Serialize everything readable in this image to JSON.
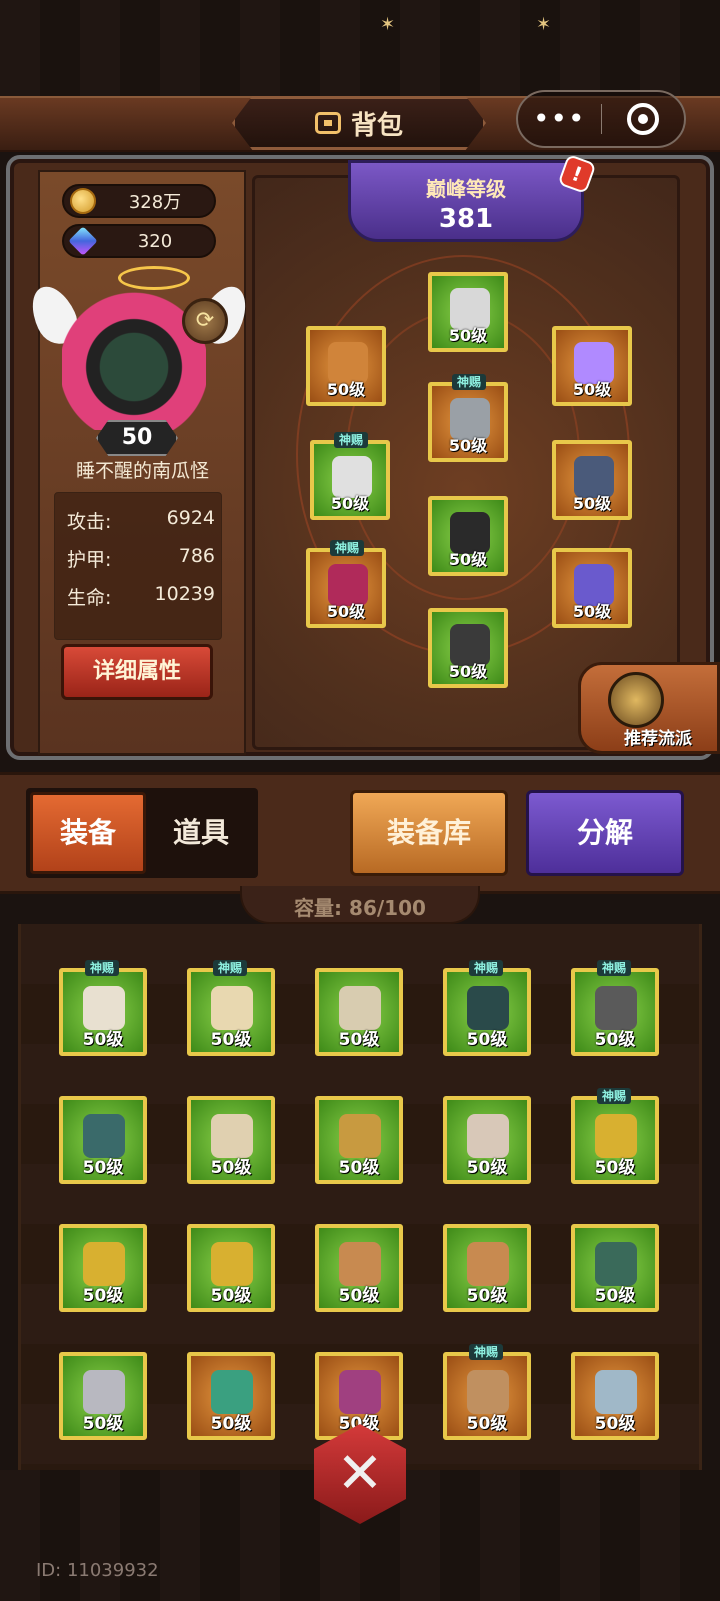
{
  "header": {
    "title": "背包",
    "title_icon": "backpack-icon",
    "more_label": "•••"
  },
  "currency": {
    "coins": "328万",
    "gems": "320"
  },
  "character": {
    "level": "50",
    "name": "睡不醒的南瓜怪"
  },
  "stats": [
    {
      "label": "攻击:",
      "value": "6924"
    },
    {
      "label": "护甲:",
      "value": "786"
    },
    {
      "label": "生命:",
      "value": "10239"
    }
  ],
  "detail_button": "详细属性",
  "peak": {
    "title": "巅峰等级",
    "value": "381",
    "alert": "!"
  },
  "equipped": [
    {
      "slot": "helmet",
      "level": "50级",
      "tag": "",
      "rarity": "green"
    },
    {
      "slot": "shoulder",
      "level": "50级",
      "tag": "",
      "rarity": "orange"
    },
    {
      "slot": "necklace",
      "level": "50级",
      "tag": "",
      "rarity": "orange"
    },
    {
      "slot": "armor",
      "level": "50级",
      "tag": "神赐",
      "rarity": "orange"
    },
    {
      "slot": "gloves",
      "level": "50级",
      "tag": "神赐",
      "rarity": "green"
    },
    {
      "slot": "bracelet",
      "level": "50级",
      "tag": "",
      "rarity": "orange"
    },
    {
      "slot": "pants",
      "level": "50级",
      "tag": "",
      "rarity": "green"
    },
    {
      "slot": "weapon",
      "level": "50级",
      "tag": "神赐",
      "rarity": "orange"
    },
    {
      "slot": "ring",
      "level": "50级",
      "tag": "",
      "rarity": "orange"
    },
    {
      "slot": "boots",
      "level": "50级",
      "tag": "",
      "rarity": "green"
    }
  ],
  "recommend_label": "推荐流派",
  "tabs": {
    "equipment": "装备",
    "items": "道具"
  },
  "buttons": {
    "storage": "装备库",
    "decompose": "分解"
  },
  "capacity": "容量: 86/100",
  "inventory": [
    {
      "level": "50级",
      "tag": "神赐",
      "rarity": "green"
    },
    {
      "level": "50级",
      "tag": "神赐",
      "rarity": "green"
    },
    {
      "level": "50级",
      "tag": "",
      "rarity": "green"
    },
    {
      "level": "50级",
      "tag": "神赐",
      "rarity": "green"
    },
    {
      "level": "50级",
      "tag": "神赐",
      "rarity": "green"
    },
    {
      "level": "50级",
      "tag": "",
      "rarity": "green"
    },
    {
      "level": "50级",
      "tag": "",
      "rarity": "green"
    },
    {
      "level": "50级",
      "tag": "",
      "rarity": "green"
    },
    {
      "level": "50级",
      "tag": "",
      "rarity": "green"
    },
    {
      "level": "50级",
      "tag": "神赐",
      "rarity": "green"
    },
    {
      "level": "50级",
      "tag": "",
      "rarity": "green"
    },
    {
      "level": "50级",
      "tag": "",
      "rarity": "green"
    },
    {
      "level": "50级",
      "tag": "",
      "rarity": "green"
    },
    {
      "level": "50级",
      "tag": "",
      "rarity": "green"
    },
    {
      "level": "50级",
      "tag": "",
      "rarity": "green"
    },
    {
      "level": "50级",
      "tag": "",
      "rarity": "green"
    },
    {
      "level": "50级",
      "tag": "",
      "rarity": "orange"
    },
    {
      "level": "50级",
      "tag": "",
      "rarity": "orange"
    },
    {
      "level": "50级",
      "tag": "神赐",
      "rarity": "orange"
    },
    {
      "level": "50级",
      "tag": "",
      "rarity": "orange"
    }
  ],
  "footer": {
    "id": "ID: 11039932"
  }
}
